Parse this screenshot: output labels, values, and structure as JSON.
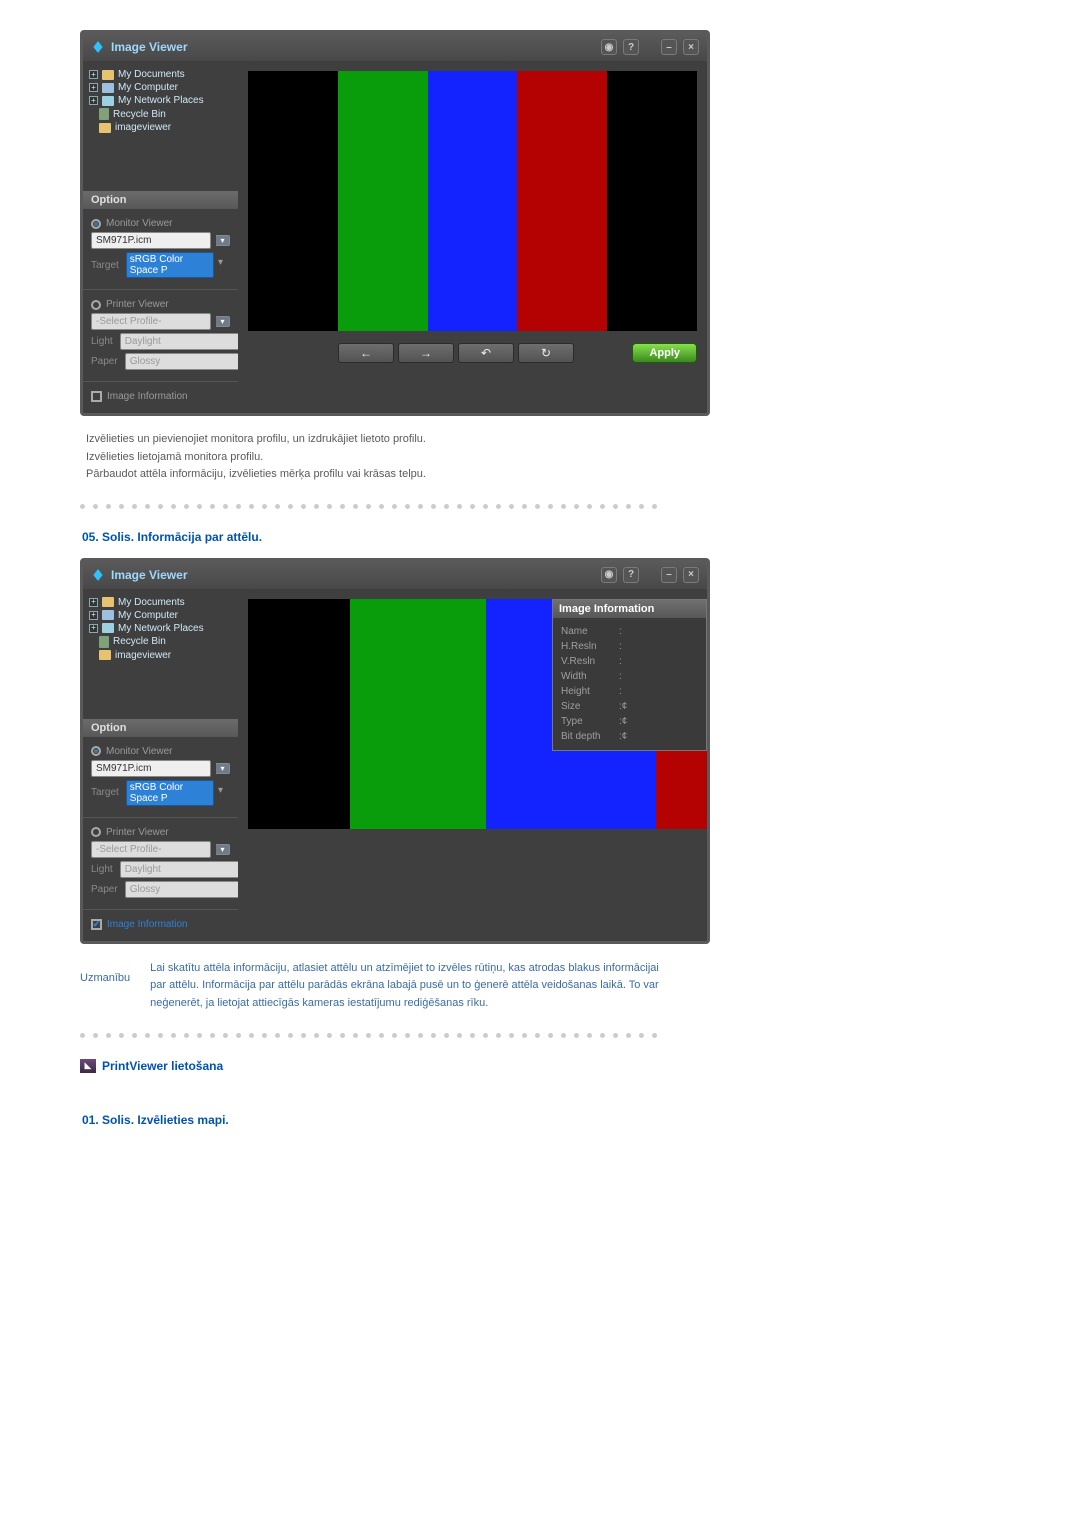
{
  "app": {
    "title": "Image Viewer"
  },
  "tree": {
    "items": [
      {
        "label": "My Documents",
        "expandable": true
      },
      {
        "label": "My Computer",
        "expandable": true
      },
      {
        "label": "My Network Places",
        "expandable": true
      },
      {
        "label": "Recycle Bin",
        "expandable": false
      },
      {
        "label": "imageviewer",
        "expandable": false
      }
    ]
  },
  "option": {
    "header": "Option",
    "monitor": {
      "label": "Monitor Viewer",
      "profile": "SM971P.icm",
      "targetLabel": "Target",
      "targetValue": "sRGB Color Space P"
    },
    "printer": {
      "label": "Printer Viewer",
      "profilePlaceholder": "-Select Profile-",
      "lightLabel": "Light",
      "lightValue": "Daylight",
      "paperLabel": "Paper",
      "paperValue": "Glossy"
    },
    "imageInfoLabel": "Image Information"
  },
  "buttons": {
    "apply": "Apply"
  },
  "imageInfo": {
    "title": "Image Information",
    "fields": {
      "name": "Name",
      "hres": "H.Resln",
      "vres": "V.Resln",
      "width": "Width",
      "height": "Height",
      "size": "Size",
      "type": "Type",
      "bitdepth": "Bit depth"
    },
    "values": {
      "size": "¢",
      "type": "¢",
      "bitdepth": "¢"
    }
  },
  "doc": {
    "para1": "Izvēlieties un pievienojiet monitora profilu, un izdrukājiet lietoto profilu.",
    "para2": "Izvēlieties lietojamā monitora profilu.",
    "para3": "Pārbaudot attēla informāciju, izvēlieties mērķa profilu vai krāsas telpu.",
    "step05": "05. Solis. Informācija par attēlu.",
    "notice_label": "Uzmanību",
    "notice_text": "Lai skatītu attēla informāciju, atlasiet attēlu un atzīmējiet to izvēles rūtiņu, kas atrodas blakus informācijai par attēlu. Informācija par attēlu parādās ekrāna labajā pusē un to ģenerē attēla veidošanas laikā. To var neģenerēt, ja lietojat attiecīgās kameras iestatījumu rediģēšanas rīku.",
    "printviewer_heading": "PrintViewer lietošana",
    "step01": "01. Solis. Izvēlieties mapi."
  }
}
